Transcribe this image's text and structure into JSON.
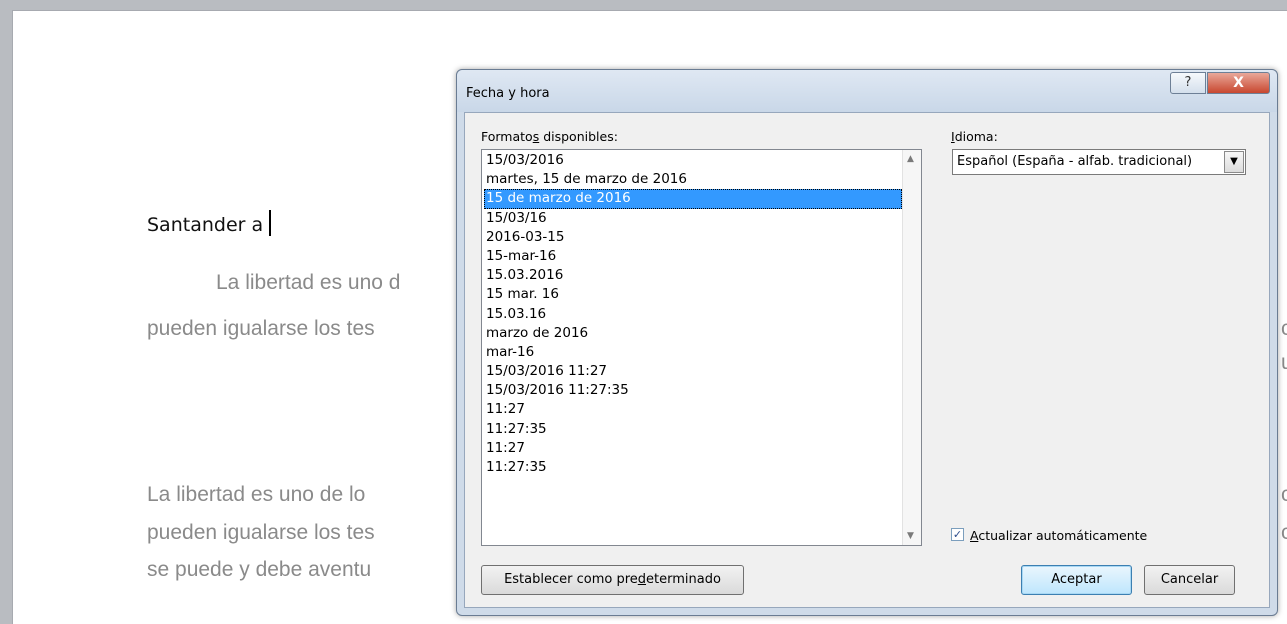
{
  "document": {
    "heading": "Santander a",
    "para1_line1": "La libertad es uno d",
    "para1_line2": "pueden igualarse los tes",
    "para2_line1": "La libertad es uno de lo",
    "para2_line2": "pueden igualarse los tes",
    "para2_line3": "se puede y debe aventu",
    "right_fragments": [
      "c",
      "u",
      "c",
      "c"
    ]
  },
  "dialog": {
    "title": "Fecha y hora",
    "help_glyph": "?",
    "close_glyph": "X",
    "formats_label_pre": "Formato",
    "formats_label_u": "s",
    "formats_label_post": " disponibles:",
    "formats": [
      "15/03/2016",
      "martes, 15 de marzo de 2016",
      "15 de marzo de 2016",
      "15/03/16",
      "2016-03-15",
      "15-mar-16",
      "15.03.2016",
      "15 mar. 16",
      "15.03.16",
      "marzo de 2016",
      "mar-16",
      "15/03/2016 11:27",
      "15/03/2016 11:27:35",
      "11:27",
      "11:27:35",
      "11:27",
      "11:27:35"
    ],
    "selected_index": 2,
    "language_label_u": "I",
    "language_label_post": "dioma:",
    "language_value": "Español (España - alfab. tradicional)",
    "auto_update_u": "A",
    "auto_update_post": "ctualizar automáticamente",
    "auto_update_checked": true,
    "set_default_pre": "Establecer como pre",
    "set_default_u": "d",
    "set_default_post": "eterminado",
    "ok_label": "Aceptar",
    "cancel_label": "Cancelar"
  }
}
